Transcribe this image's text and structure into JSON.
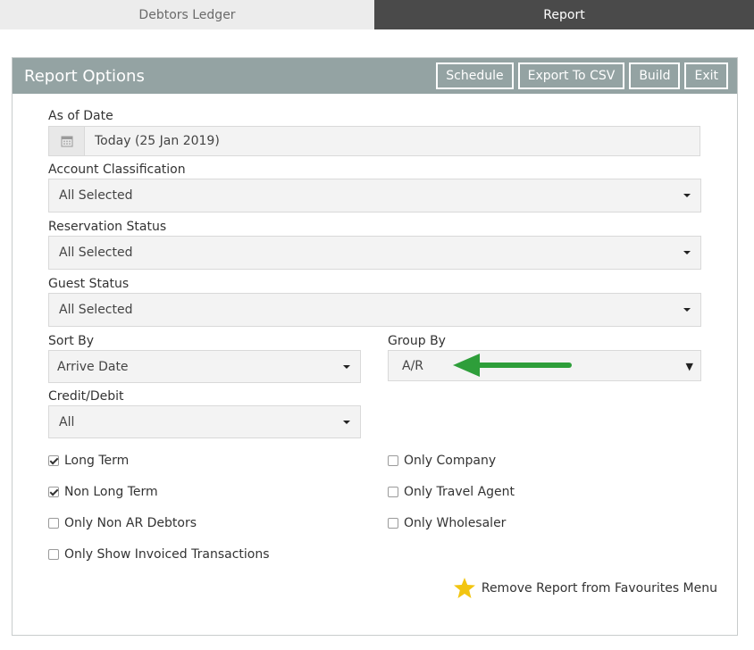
{
  "tabs": [
    {
      "label": "Debtors Ledger"
    },
    {
      "label": "Report"
    }
  ],
  "panel": {
    "title": "Report Options",
    "buttons": {
      "schedule": "Schedule",
      "export": "Export To CSV",
      "build": "Build",
      "exit": "Exit"
    }
  },
  "fields": {
    "as_of_date": {
      "label": "As of Date",
      "value": "Today (25 Jan 2019)",
      "icon": "calendar-icon"
    },
    "account_classification": {
      "label": "Account Classification",
      "value": "All Selected"
    },
    "reservation_status": {
      "label": "Reservation Status",
      "value": "All Selected"
    },
    "guest_status": {
      "label": "Guest Status",
      "value": "All Selected"
    },
    "sort_by": {
      "label": "Sort By",
      "value": "Arrive Date"
    },
    "group_by": {
      "label": "Group By",
      "value": "A/R"
    },
    "credit_debit": {
      "label": "Credit/Debit",
      "value": "All"
    }
  },
  "checkboxes": {
    "long_term": {
      "label": "Long Term",
      "checked": true
    },
    "non_long_term": {
      "label": "Non Long Term",
      "checked": true
    },
    "only_non_ar": {
      "label": "Only Non AR Debtors",
      "checked": false
    },
    "only_invoiced": {
      "label": "Only Show Invoiced Transactions",
      "checked": false
    },
    "only_company": {
      "label": "Only Company",
      "checked": false
    },
    "only_travel_agent": {
      "label": "Only Travel Agent",
      "checked": false
    },
    "only_wholesaler": {
      "label": "Only Wholesaler",
      "checked": false
    }
  },
  "favourites": {
    "label": "Remove Report from Favourites Menu",
    "icon": "star-icon",
    "color": "#f2c511"
  },
  "annotation": {
    "icon": "green-arrow-icon",
    "color": "#2e9e3a"
  }
}
